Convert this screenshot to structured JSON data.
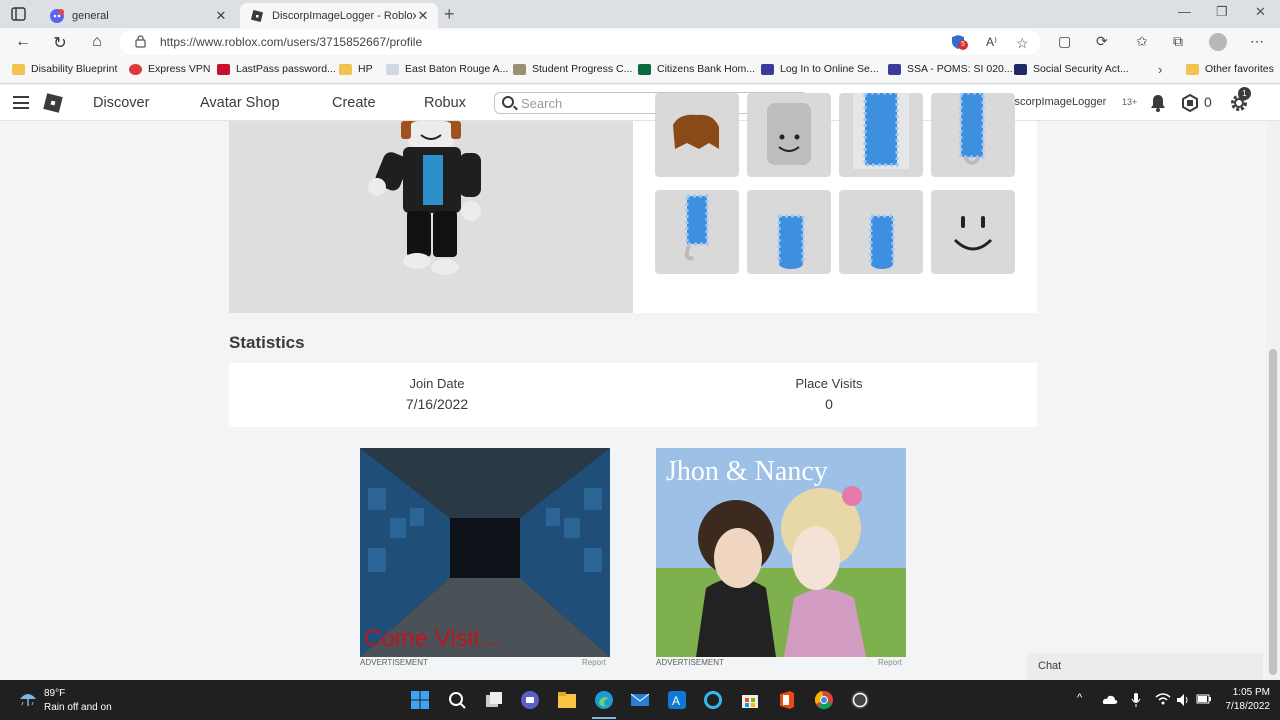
{
  "browser": {
    "tabs": [
      {
        "title": "general",
        "active": false
      },
      {
        "title": "DiscorpImageLogger - Roblox",
        "active": true
      }
    ],
    "url": "https://www.roblox.com/users/3715852667/profile",
    "favorites": [
      {
        "label": "Disability Blueprint",
        "icon": "folder-icon"
      },
      {
        "label": "Express VPN",
        "icon": "expressvpn-icon"
      },
      {
        "label": "LastPass password...",
        "icon": "lastpass-icon"
      },
      {
        "label": "HP",
        "icon": "folder-icon"
      },
      {
        "label": "East Baton Rouge A...",
        "icon": "page-icon"
      },
      {
        "label": "Student Progress C...",
        "icon": "page-icon"
      },
      {
        "label": "Citizens Bank Hom...",
        "icon": "citizens-icon"
      },
      {
        "label": "Log In to Online Se...",
        "icon": "ssa-icon"
      },
      {
        "label": "SSA - POMS: SI 020...",
        "icon": "ssa-icon"
      },
      {
        "label": "Social Security Act...",
        "icon": "ssa-icon"
      }
    ],
    "other_favorites": "Other favorites",
    "notification_count": "5"
  },
  "roblox_header": {
    "nav": [
      "Discover",
      "Avatar Shop",
      "Create",
      "Robux"
    ],
    "search_placeholder": "Search",
    "username": "@DiscorpImageLogger",
    "age_badge": "13+",
    "robux_balance": "0",
    "settings_badge": "1"
  },
  "statistics": {
    "heading": "Statistics",
    "join_date_label": "Join Date",
    "join_date_value": "7/16/2022",
    "place_visits_label": "Place Visits",
    "place_visits_value": "0"
  },
  "ads": [
    {
      "label": "ADVERTISEMENT",
      "report": "Report",
      "caption": "Come Visit..."
    },
    {
      "label": "ADVERTISEMENT",
      "report": "Report",
      "caption": "Jhon & Nancy"
    }
  ],
  "chat": {
    "label": "Chat"
  },
  "taskbar": {
    "temperature": "89°F",
    "weather": "Rain off and on",
    "time": "1:05 PM",
    "date": "7/18/2022"
  },
  "colors": {
    "page_bg": "#f2f4f5",
    "card_bg": "#ffffff",
    "avatar_bg": "#dcdedf",
    "text": "#393b3d",
    "taskbar": "#202020"
  }
}
